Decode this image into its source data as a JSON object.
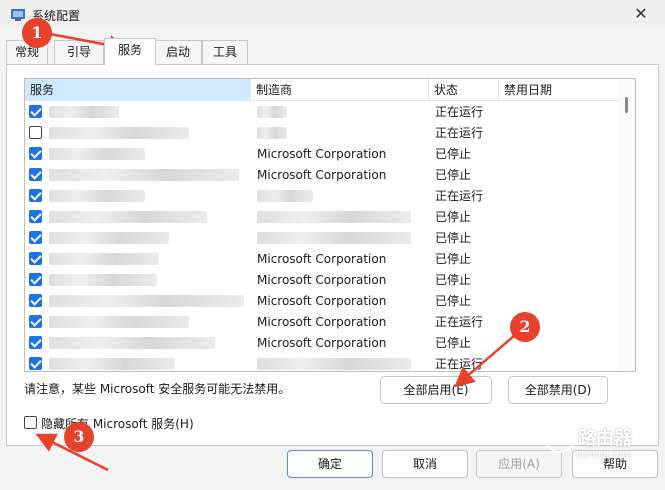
{
  "window": {
    "title": "系统配置"
  },
  "tabs": [
    {
      "label": "常规"
    },
    {
      "label": "引导"
    },
    {
      "label": "服务"
    },
    {
      "label": "启动"
    },
    {
      "label": "工具"
    }
  ],
  "columns": {
    "service": "服务",
    "manufacturer": "制造商",
    "status": "状态",
    "disabled_date": "禁用日期"
  },
  "rows": [
    {
      "manufacturer": "",
      "status": "正在运行",
      "checked": true
    },
    {
      "manufacturer": "",
      "status": "正在运行",
      "checked": false
    },
    {
      "manufacturer": "Microsoft Corporation",
      "status": "已停止",
      "checked": true
    },
    {
      "manufacturer": "Microsoft Corporation",
      "status": "已停止",
      "checked": true
    },
    {
      "manufacturer": "",
      "status": "正在运行",
      "checked": true
    },
    {
      "manufacturer": "",
      "status": "已停止",
      "checked": true
    },
    {
      "manufacturer": "",
      "status": "已停止",
      "checked": true
    },
    {
      "manufacturer": "Microsoft Corporation",
      "status": "已停止",
      "checked": true
    },
    {
      "manufacturer": "Microsoft Corporation",
      "status": "已停止",
      "checked": true
    },
    {
      "manufacturer": "Microsoft Corporation",
      "status": "已停止",
      "checked": true
    },
    {
      "manufacturer": "Microsoft Corporation",
      "status": "正在运行",
      "checked": true
    },
    {
      "manufacturer": "Microsoft Corporation",
      "status": "已停止",
      "checked": true
    },
    {
      "manufacturer": "",
      "status": "正在运行",
      "checked": true
    }
  ],
  "notice": "请注意，某些 Microsoft 安全服务可能无法禁用。",
  "buttons": {
    "enable_all": "全部启用(E)",
    "disable_all": "全部禁用(D)",
    "ok": "确定",
    "cancel": "取消",
    "apply": "应用(A)",
    "help": "帮助"
  },
  "hide_ms": {
    "label": "隐藏所有 Microsoft 服务(H)",
    "checked": false
  },
  "annotations": [
    "1",
    "2",
    "3"
  ],
  "annotation_color": "#e6412a",
  "watermark": {
    "name": "路由器",
    "url": "luyouqi.com"
  }
}
